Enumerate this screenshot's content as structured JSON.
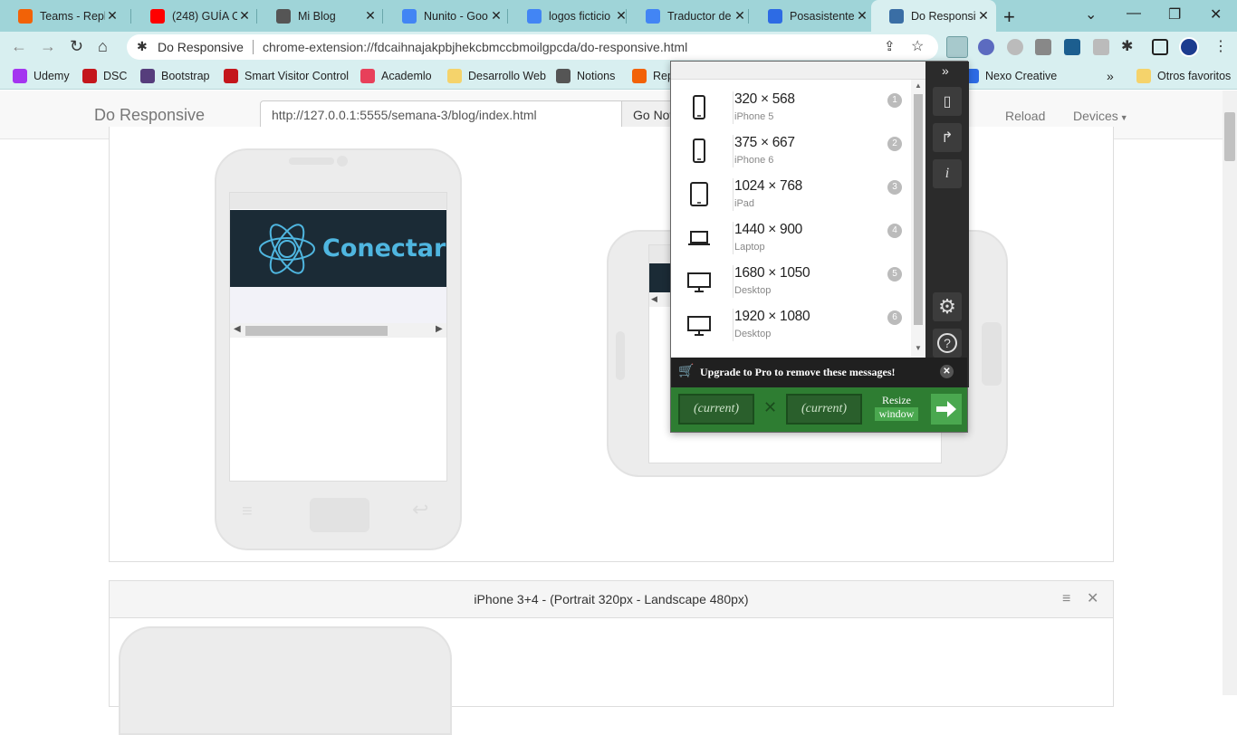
{
  "tabs": [
    {
      "title": "Teams - Repl",
      "icon": "replit-icon",
      "color": "#f26207"
    },
    {
      "title": "(248) GUÍA C",
      "icon": "youtube-icon",
      "color": "#ff0000"
    },
    {
      "title": "Mi Blog",
      "icon": "podcast-icon",
      "color": "#555555"
    },
    {
      "title": "Nunito - Goo",
      "icon": "google-fonts-icon",
      "color": "#4285f4"
    },
    {
      "title": "logos ficticio",
      "icon": "google-icon",
      "color": "#4285f4"
    },
    {
      "title": "Traductor de",
      "icon": "translate-icon",
      "color": "#4285f4"
    },
    {
      "title": "Posasistente",
      "icon": "z-icon",
      "color": "#2d6be4"
    },
    {
      "title": "Do Responsiv",
      "icon": "tablet-icon",
      "color": "#3a6ea5"
    }
  ],
  "toolbar": {
    "site_name": "Do Responsive",
    "url": "chrome-extension://fdcaihnajakpbjhekcbmccbmoilgpcda/do-responsive.html"
  },
  "bookmarks": [
    {
      "label": "Udemy",
      "icon": "udemy-icon",
      "color": "#a435f0"
    },
    {
      "label": "DSC",
      "icon": "dsc-icon",
      "color": "#c4161c"
    },
    {
      "label": "Bootstrap",
      "icon": "bootstrap-icon",
      "color": "#563d7c"
    },
    {
      "label": "Smart Visitor Control",
      "icon": "shield-icon",
      "color": "#c4161c"
    },
    {
      "label": "Academlo",
      "icon": "academlo-icon",
      "color": "#e8405a"
    },
    {
      "label": "Desarrollo Web",
      "icon": "folder-icon",
      "color": "#f5d36b"
    },
    {
      "label": "Notions",
      "icon": "notions-icon",
      "color": "#555555"
    },
    {
      "label": "Rep",
      "icon": "replit-icon",
      "color": "#f26207"
    },
    {
      "label": "Nexo Creative",
      "icon": "nexo-icon",
      "color": "#2d6be4"
    },
    {
      "label": "Otros favoritos",
      "icon": "folder-icon",
      "color": "#f5d36b"
    }
  ],
  "page": {
    "brand": "Do Responsive",
    "url_value": "http://127.0.0.1:5555/semana-3/blog/index.html",
    "go_label": "Go Now",
    "reload_label": "Reload",
    "devices_label": "Devices",
    "panel2_title": "iPhone 3+4 - (Portrait 320px - Landscape 480px)"
  },
  "preview": {
    "logo_text": "Conectar"
  },
  "popup": {
    "devices": [
      {
        "size": "320 × 568",
        "name": "iPhone 5",
        "num": "1",
        "kind": "phone"
      },
      {
        "size": "375 × 667",
        "name": "iPhone 6",
        "num": "2",
        "kind": "phone"
      },
      {
        "size": "1024 × 768",
        "name": "iPad",
        "num": "3",
        "kind": "tablet"
      },
      {
        "size": "1440 × 900",
        "name": "Laptop",
        "num": "4",
        "kind": "laptop"
      },
      {
        "size": "1680 × 1050",
        "name": "Desktop",
        "num": "5",
        "kind": "desktop"
      },
      {
        "size": "1920 × 1080",
        "name": "Desktop",
        "num": "6",
        "kind": "desktop"
      }
    ],
    "upgrade_text": "Upgrade to Pro to remove these messages!",
    "width_value": "(current)",
    "height_value": "(current)",
    "resize_label": "Resize",
    "window_label": "window"
  }
}
